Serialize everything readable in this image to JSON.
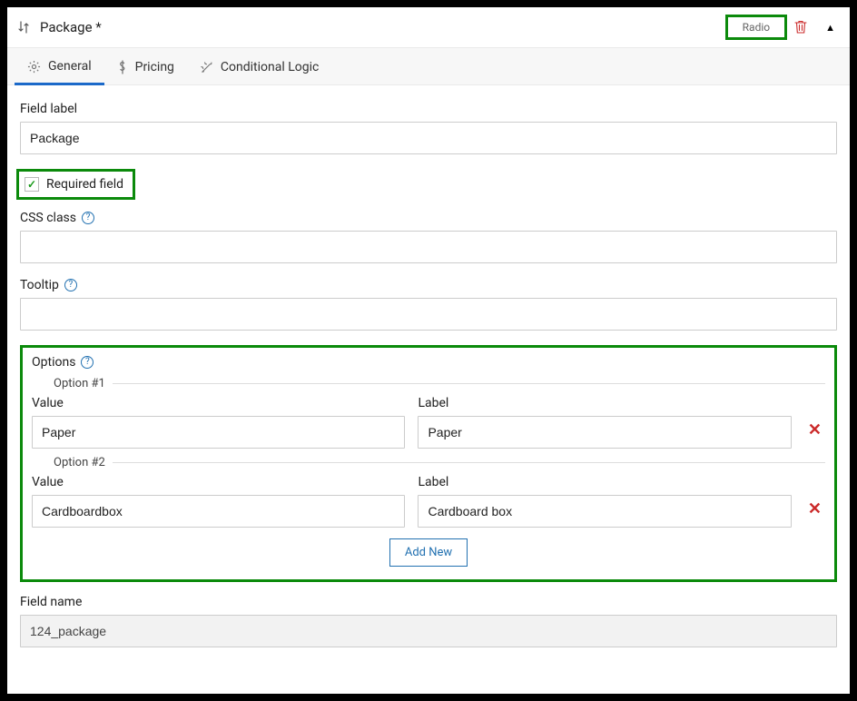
{
  "header": {
    "title": "Package *",
    "type_label": "Radio"
  },
  "tabs": {
    "general": "General",
    "pricing": "Pricing",
    "conditional": "Conditional Logic"
  },
  "fields": {
    "label_lbl": "Field label",
    "label_val": "Package",
    "required_lbl": "Required field",
    "css_lbl": "CSS class",
    "css_val": "",
    "tooltip_lbl": "Tooltip",
    "tooltip_val": "",
    "options_lbl": "Options",
    "fieldname_lbl": "Field name",
    "fieldname_val": "124_package"
  },
  "options": {
    "heading_value": "Value",
    "heading_label": "Label",
    "opt1_title": "Option #1",
    "opt1_value": "Paper",
    "opt1_label": "Paper",
    "opt2_title": "Option #2",
    "opt2_value": "Cardboardbox",
    "opt2_label": "Cardboard box",
    "add_new": "Add New"
  }
}
